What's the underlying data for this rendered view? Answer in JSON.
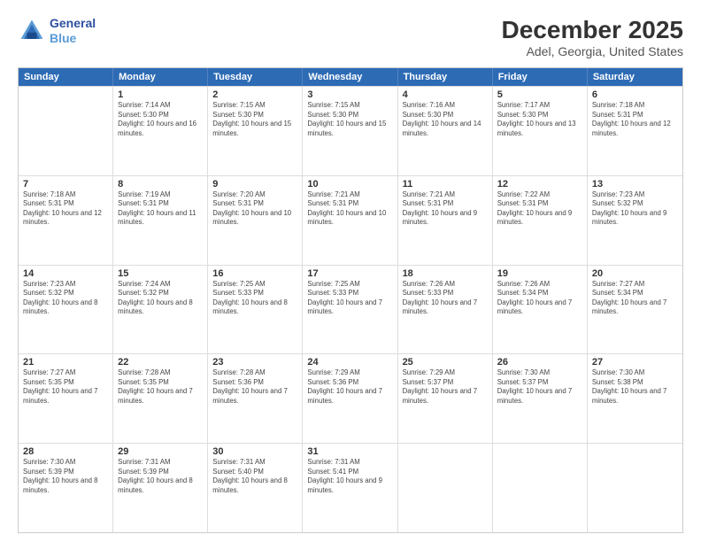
{
  "header": {
    "logo_line1": "General",
    "logo_line2": "Blue",
    "title": "December 2025",
    "subtitle": "Adel, Georgia, United States"
  },
  "days_of_week": [
    "Sunday",
    "Monday",
    "Tuesday",
    "Wednesday",
    "Thursday",
    "Friday",
    "Saturday"
  ],
  "weeks": [
    [
      {
        "num": "",
        "sunrise": "",
        "sunset": "",
        "daylight": ""
      },
      {
        "num": "1",
        "sunrise": "Sunrise: 7:14 AM",
        "sunset": "Sunset: 5:30 PM",
        "daylight": "Daylight: 10 hours and 16 minutes."
      },
      {
        "num": "2",
        "sunrise": "Sunrise: 7:15 AM",
        "sunset": "Sunset: 5:30 PM",
        "daylight": "Daylight: 10 hours and 15 minutes."
      },
      {
        "num": "3",
        "sunrise": "Sunrise: 7:15 AM",
        "sunset": "Sunset: 5:30 PM",
        "daylight": "Daylight: 10 hours and 15 minutes."
      },
      {
        "num": "4",
        "sunrise": "Sunrise: 7:16 AM",
        "sunset": "Sunset: 5:30 PM",
        "daylight": "Daylight: 10 hours and 14 minutes."
      },
      {
        "num": "5",
        "sunrise": "Sunrise: 7:17 AM",
        "sunset": "Sunset: 5:30 PM",
        "daylight": "Daylight: 10 hours and 13 minutes."
      },
      {
        "num": "6",
        "sunrise": "Sunrise: 7:18 AM",
        "sunset": "Sunset: 5:31 PM",
        "daylight": "Daylight: 10 hours and 12 minutes."
      }
    ],
    [
      {
        "num": "7",
        "sunrise": "Sunrise: 7:18 AM",
        "sunset": "Sunset: 5:31 PM",
        "daylight": "Daylight: 10 hours and 12 minutes."
      },
      {
        "num": "8",
        "sunrise": "Sunrise: 7:19 AM",
        "sunset": "Sunset: 5:31 PM",
        "daylight": "Daylight: 10 hours and 11 minutes."
      },
      {
        "num": "9",
        "sunrise": "Sunrise: 7:20 AM",
        "sunset": "Sunset: 5:31 PM",
        "daylight": "Daylight: 10 hours and 10 minutes."
      },
      {
        "num": "10",
        "sunrise": "Sunrise: 7:21 AM",
        "sunset": "Sunset: 5:31 PM",
        "daylight": "Daylight: 10 hours and 10 minutes."
      },
      {
        "num": "11",
        "sunrise": "Sunrise: 7:21 AM",
        "sunset": "Sunset: 5:31 PM",
        "daylight": "Daylight: 10 hours and 9 minutes."
      },
      {
        "num": "12",
        "sunrise": "Sunrise: 7:22 AM",
        "sunset": "Sunset: 5:31 PM",
        "daylight": "Daylight: 10 hours and 9 minutes."
      },
      {
        "num": "13",
        "sunrise": "Sunrise: 7:23 AM",
        "sunset": "Sunset: 5:32 PM",
        "daylight": "Daylight: 10 hours and 9 minutes."
      }
    ],
    [
      {
        "num": "14",
        "sunrise": "Sunrise: 7:23 AM",
        "sunset": "Sunset: 5:32 PM",
        "daylight": "Daylight: 10 hours and 8 minutes."
      },
      {
        "num": "15",
        "sunrise": "Sunrise: 7:24 AM",
        "sunset": "Sunset: 5:32 PM",
        "daylight": "Daylight: 10 hours and 8 minutes."
      },
      {
        "num": "16",
        "sunrise": "Sunrise: 7:25 AM",
        "sunset": "Sunset: 5:33 PM",
        "daylight": "Daylight: 10 hours and 8 minutes."
      },
      {
        "num": "17",
        "sunrise": "Sunrise: 7:25 AM",
        "sunset": "Sunset: 5:33 PM",
        "daylight": "Daylight: 10 hours and 7 minutes."
      },
      {
        "num": "18",
        "sunrise": "Sunrise: 7:26 AM",
        "sunset": "Sunset: 5:33 PM",
        "daylight": "Daylight: 10 hours and 7 minutes."
      },
      {
        "num": "19",
        "sunrise": "Sunrise: 7:26 AM",
        "sunset": "Sunset: 5:34 PM",
        "daylight": "Daylight: 10 hours and 7 minutes."
      },
      {
        "num": "20",
        "sunrise": "Sunrise: 7:27 AM",
        "sunset": "Sunset: 5:34 PM",
        "daylight": "Daylight: 10 hours and 7 minutes."
      }
    ],
    [
      {
        "num": "21",
        "sunrise": "Sunrise: 7:27 AM",
        "sunset": "Sunset: 5:35 PM",
        "daylight": "Daylight: 10 hours and 7 minutes."
      },
      {
        "num": "22",
        "sunrise": "Sunrise: 7:28 AM",
        "sunset": "Sunset: 5:35 PM",
        "daylight": "Daylight: 10 hours and 7 minutes."
      },
      {
        "num": "23",
        "sunrise": "Sunrise: 7:28 AM",
        "sunset": "Sunset: 5:36 PM",
        "daylight": "Daylight: 10 hours and 7 minutes."
      },
      {
        "num": "24",
        "sunrise": "Sunrise: 7:29 AM",
        "sunset": "Sunset: 5:36 PM",
        "daylight": "Daylight: 10 hours and 7 minutes."
      },
      {
        "num": "25",
        "sunrise": "Sunrise: 7:29 AM",
        "sunset": "Sunset: 5:37 PM",
        "daylight": "Daylight: 10 hours and 7 minutes."
      },
      {
        "num": "26",
        "sunrise": "Sunrise: 7:30 AM",
        "sunset": "Sunset: 5:37 PM",
        "daylight": "Daylight: 10 hours and 7 minutes."
      },
      {
        "num": "27",
        "sunrise": "Sunrise: 7:30 AM",
        "sunset": "Sunset: 5:38 PM",
        "daylight": "Daylight: 10 hours and 7 minutes."
      }
    ],
    [
      {
        "num": "28",
        "sunrise": "Sunrise: 7:30 AM",
        "sunset": "Sunset: 5:39 PM",
        "daylight": "Daylight: 10 hours and 8 minutes."
      },
      {
        "num": "29",
        "sunrise": "Sunrise: 7:31 AM",
        "sunset": "Sunset: 5:39 PM",
        "daylight": "Daylight: 10 hours and 8 minutes."
      },
      {
        "num": "30",
        "sunrise": "Sunrise: 7:31 AM",
        "sunset": "Sunset: 5:40 PM",
        "daylight": "Daylight: 10 hours and 8 minutes."
      },
      {
        "num": "31",
        "sunrise": "Sunrise: 7:31 AM",
        "sunset": "Sunset: 5:41 PM",
        "daylight": "Daylight: 10 hours and 9 minutes."
      },
      {
        "num": "",
        "sunrise": "",
        "sunset": "",
        "daylight": ""
      },
      {
        "num": "",
        "sunrise": "",
        "sunset": "",
        "daylight": ""
      },
      {
        "num": "",
        "sunrise": "",
        "sunset": "",
        "daylight": ""
      }
    ]
  ]
}
